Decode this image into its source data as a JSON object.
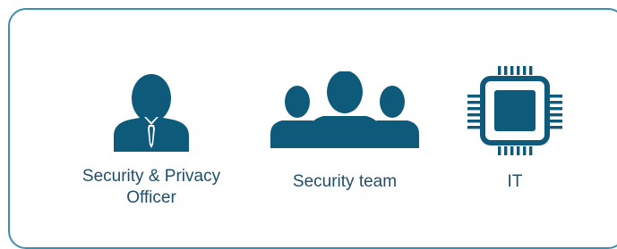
{
  "roles": [
    {
      "label": "Security & Privacy Officer",
      "icon": "officer-with-tie-icon"
    },
    {
      "label": "Security team",
      "icon": "group-icon"
    },
    {
      "label": "IT",
      "icon": "microchip-icon"
    }
  ],
  "colors": {
    "border": "#3b8fae",
    "icon": "#0e5a7a",
    "text": "#1f4e6b"
  }
}
